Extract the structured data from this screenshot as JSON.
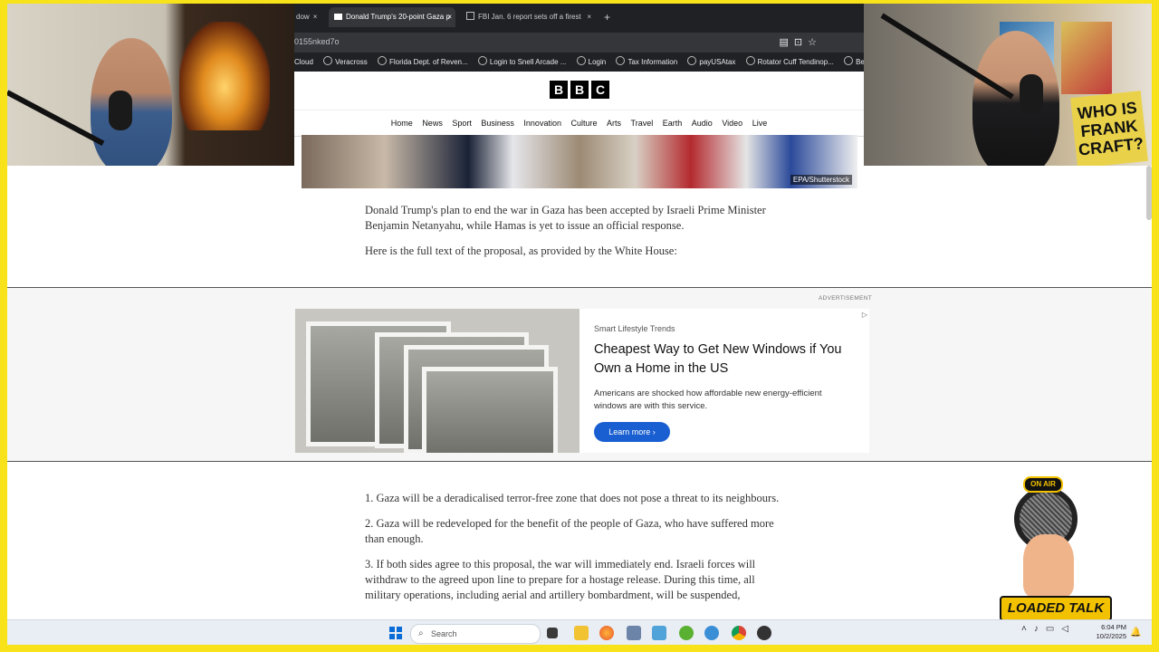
{
  "browser": {
    "tabs": [
      {
        "label": "dow",
        "close": "×"
      },
      {
        "label": "Donald Trump's 20-point Gaza p",
        "close": "×"
      },
      {
        "label": "FBI Jan. 6 report sets off a firest",
        "close": "×"
      }
    ],
    "new_tab": "+",
    "url": "0155nked7o",
    "bookmarks": [
      "Cloud",
      "Veracross",
      "Florida Dept. of Reven...",
      "Login to Snell Arcade ...",
      "Login",
      "Tax Information",
      "payUSAtax",
      "Rotator Cuff Tendinop...",
      "Best Paleo S"
    ]
  },
  "site": {
    "logo_letters": [
      "B",
      "B",
      "C"
    ],
    "nav": [
      "Home",
      "News",
      "Sport",
      "Business",
      "Innovation",
      "Culture",
      "Arts",
      "Travel",
      "Earth",
      "Audio",
      "Video",
      "Live"
    ],
    "hero_credit": "EPA/Shutterstock"
  },
  "article": {
    "intro": [
      "Donald Trump's plan to end the war in Gaza has been accepted by Israeli Prime Minister Benjamin Netanyahu, while Hamas is yet to issue an official response.",
      "Here is the full text of the proposal, as provided by the White House:"
    ],
    "points": [
      "1. Gaza will be a deradicalised terror-free zone that does not pose a threat to its neighbours.",
      "2. Gaza will be redeveloped for the benefit of the people of Gaza, who have suffered more than enough.",
      "3. If both sides agree to this proposal, the war will immediately end. Israeli forces will withdraw to the agreed upon line to prepare for a hostage release. During this time, all military operations, including aerial and artillery bombardment, will be suspended,"
    ]
  },
  "ad": {
    "label": "ADVERTISEMENT",
    "sponsor": "Smart Lifestyle Trends",
    "title": "Cheapest Way to Get New Windows if You Own a Home in the US",
    "description": "Americans are shocked how affordable new energy-efficient windows are with this service.",
    "cta": "Learn more",
    "cta_arrow": "›"
  },
  "stream": {
    "on_air": "ON AIR",
    "show_name": "LOADED TALK",
    "sign_text": "WHO IS FRANK CRAFT?"
  },
  "taskbar": {
    "search_placeholder": "Search",
    "time": "6:04 PM",
    "date": "10/2/2025"
  },
  "colors": {
    "frame_border": "#f8e21a",
    "ad_button": "#1a5fd1",
    "chrome_dark": "#202124"
  }
}
